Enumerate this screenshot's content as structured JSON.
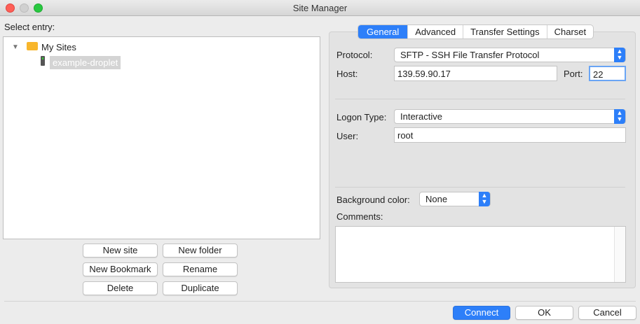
{
  "window": {
    "title": "Site Manager"
  },
  "left": {
    "select_label": "Select entry:",
    "tree": {
      "folder": "My Sites",
      "site": "example-droplet"
    },
    "buttons": {
      "new_site": "New site",
      "new_folder": "New folder",
      "new_bookmark": "New Bookmark",
      "rename": "Rename",
      "delete": "Delete",
      "duplicate": "Duplicate"
    }
  },
  "tabs": [
    "General",
    "Advanced",
    "Transfer Settings",
    "Charset"
  ],
  "general": {
    "protocol_label": "Protocol:",
    "protocol_value": "SFTP - SSH File Transfer Protocol",
    "host_label": "Host:",
    "host_value": "139.59.90.17",
    "port_label": "Port:",
    "port_value": "22",
    "logon_label": "Logon Type:",
    "logon_value": "Interactive",
    "user_label": "User:",
    "user_value": "root",
    "bg_label": "Background color:",
    "bg_value": "None",
    "comments_label": "Comments:",
    "comments_value": ""
  },
  "footer": {
    "connect": "Connect",
    "ok": "OK",
    "cancel": "Cancel"
  },
  "colors": {
    "accent": "#2d7ff9",
    "selection": "#d4d4d4"
  }
}
